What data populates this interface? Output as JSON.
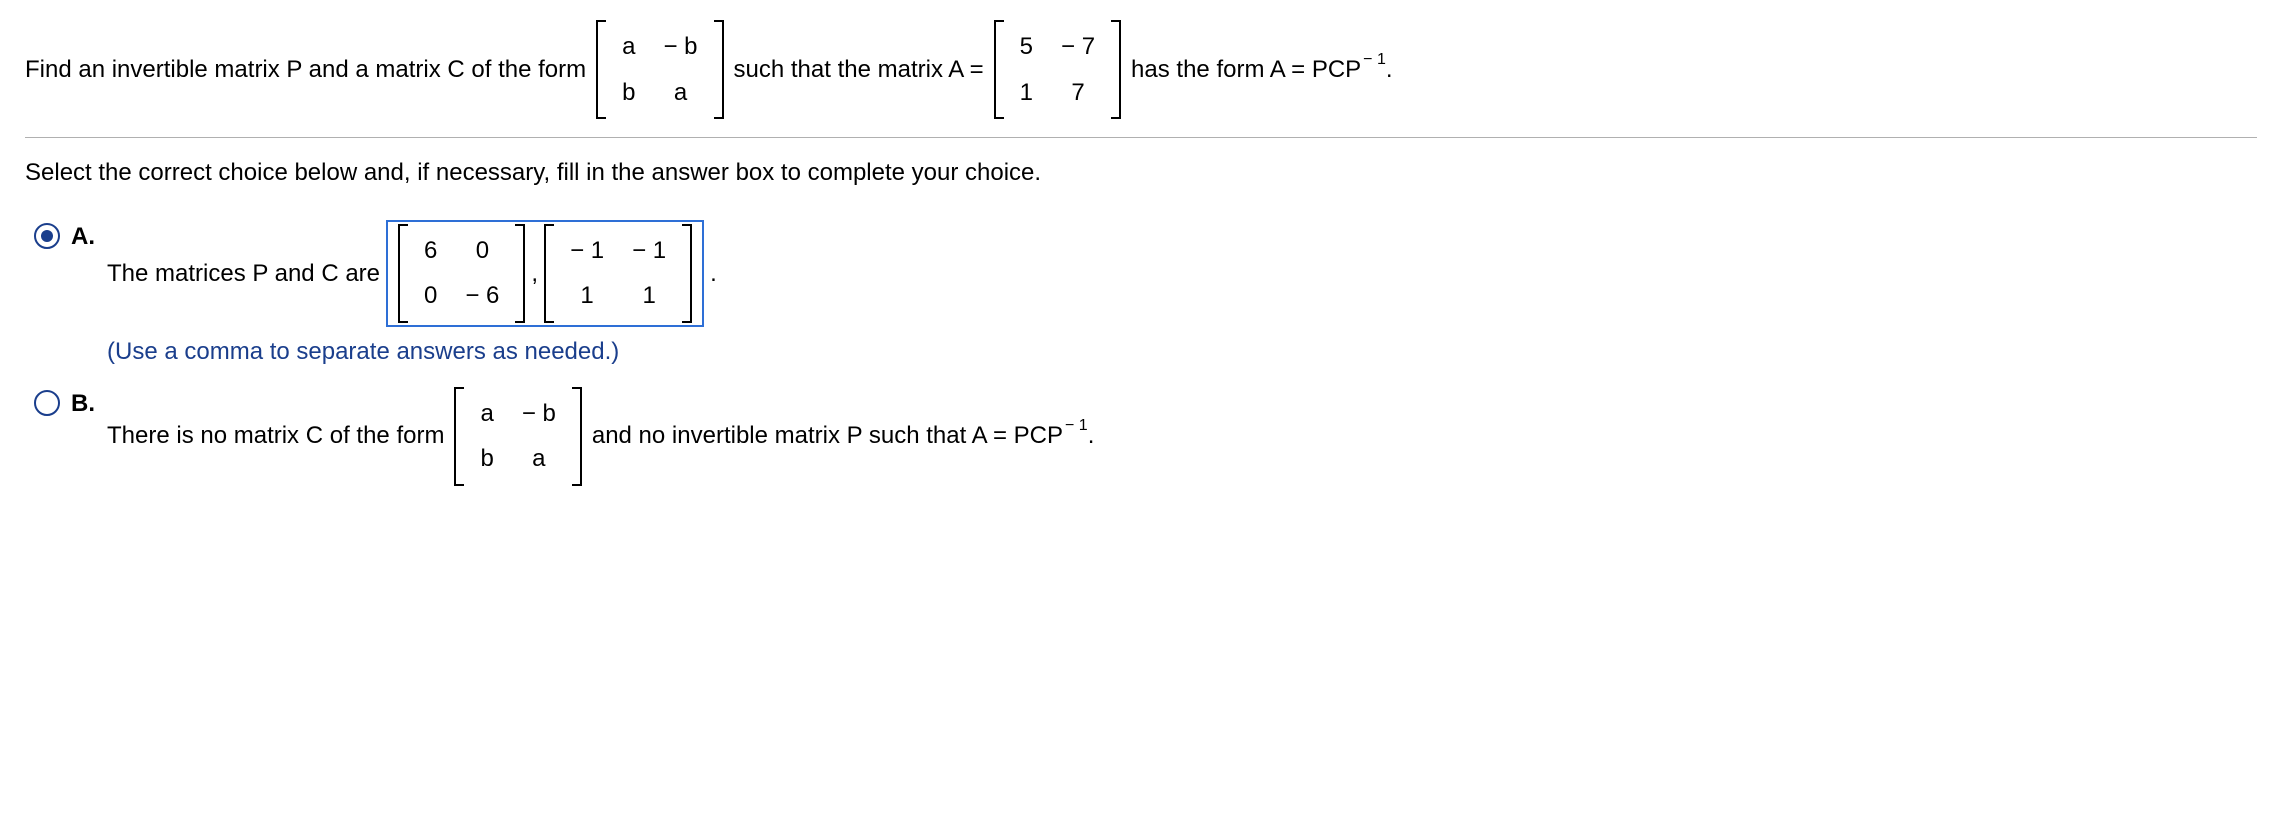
{
  "question": {
    "t1": "Find an invertible matrix P and a matrix C of the form",
    "m1": [
      [
        "a",
        "− b"
      ],
      [
        "b",
        "a"
      ]
    ],
    "t2": "such that the matrix A =",
    "m2": [
      [
        "5",
        "− 7"
      ],
      [
        "1",
        "7"
      ]
    ],
    "t3": "has the form A = PCP",
    "exp": "− 1",
    "t4": "."
  },
  "instruction": "Select the correct choice below and, if necessary, fill in the answer box to complete your choice.",
  "choices": {
    "A": {
      "letter": "A.",
      "selected": true,
      "t1": "The matrices P and C are",
      "ans_m1": [
        [
          "6",
          "0"
        ],
        [
          "0",
          "− 6"
        ]
      ],
      "sep": ",",
      "ans_m2": [
        [
          "− 1",
          "− 1"
        ],
        [
          "1",
          "1"
        ]
      ],
      "t2": ".",
      "hint": "(Use a comma to separate answers as needed.)"
    },
    "B": {
      "letter": "B.",
      "selected": false,
      "t1": "There is no matrix C of the form",
      "m1": [
        [
          "a",
          "− b"
        ],
        [
          "b",
          "a"
        ]
      ],
      "t2": "and no invertible matrix P such that A = PCP",
      "exp": "− 1",
      "t3": "."
    }
  }
}
